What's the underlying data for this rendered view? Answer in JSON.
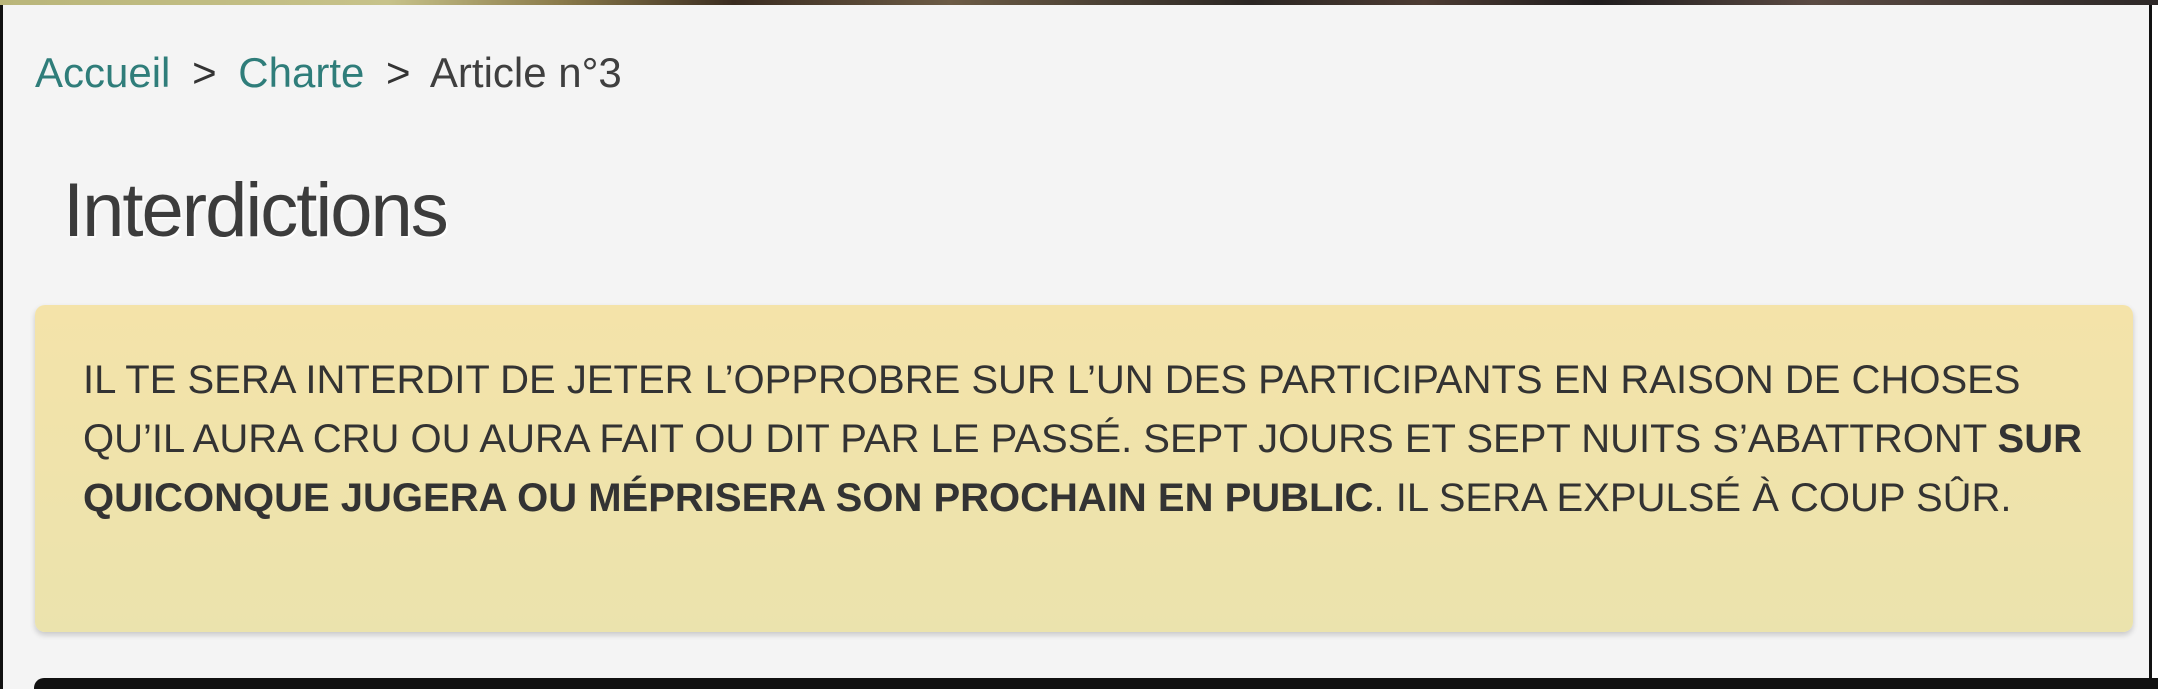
{
  "breadcrumb": {
    "home": "Accueil",
    "sep1": ">",
    "section": "Charte",
    "sep2": ">",
    "current": "Article n°3"
  },
  "page": {
    "title": "Interdictions"
  },
  "notice": {
    "text_before_bold": "IL TE SERA INTERDIT DE JETER L’OPPROBRE SUR L’UN DES PARTICIPANTS EN RAISON DE CHOSES QU’IL AURA CRU OU AURA FAIT OU DIT PAR LE PASSÉ. SEPT JOURS ET SEPT NUITS S’ABATTRONT",
    "bold_text": "SUR QUICONQUE JUGERA OU MÉPRISERA SON PROCHAIN EN PUBLIC",
    "text_after_bold": ". IL SERA EXPULSÉ À COUP SÛR."
  }
}
